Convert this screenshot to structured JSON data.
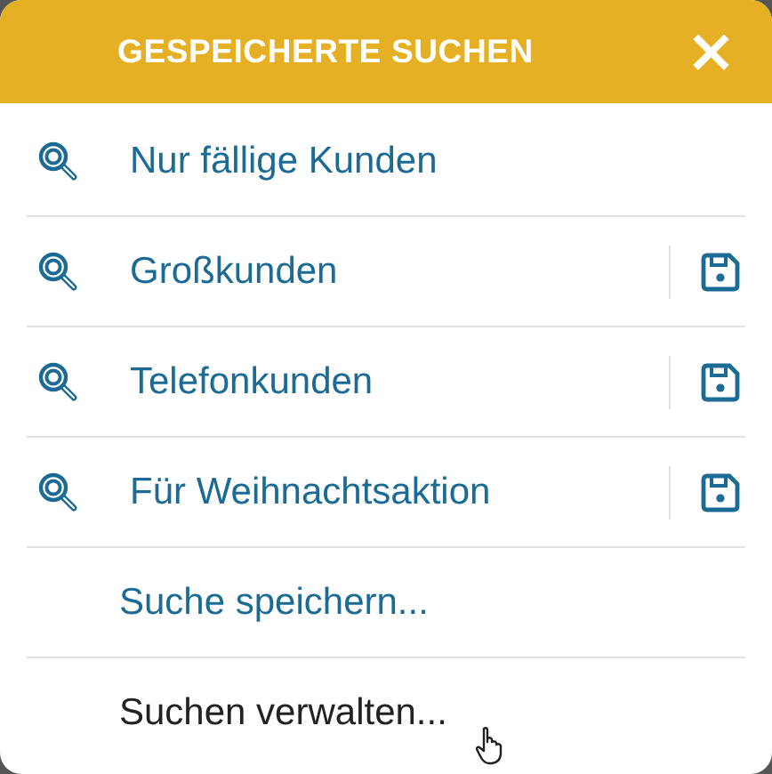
{
  "header": {
    "title": "GESPEICHERTE SUCHEN",
    "close": "×"
  },
  "items": [
    {
      "kind": "search",
      "label": "Nur fällige Kunden",
      "saveable": false,
      "hovered": false
    },
    {
      "kind": "search",
      "label": "Großkunden",
      "saveable": true,
      "hovered": false
    },
    {
      "kind": "search",
      "label": "Telefonkunden",
      "saveable": true,
      "hovered": false
    },
    {
      "kind": "search",
      "label": "Für Weihnachtsaktion",
      "saveable": true,
      "hovered": false
    },
    {
      "kind": "action",
      "label": "Suche speichern...",
      "hovered": false
    },
    {
      "kind": "action",
      "label": "Suchen verwalten...",
      "hovered": true
    }
  ]
}
